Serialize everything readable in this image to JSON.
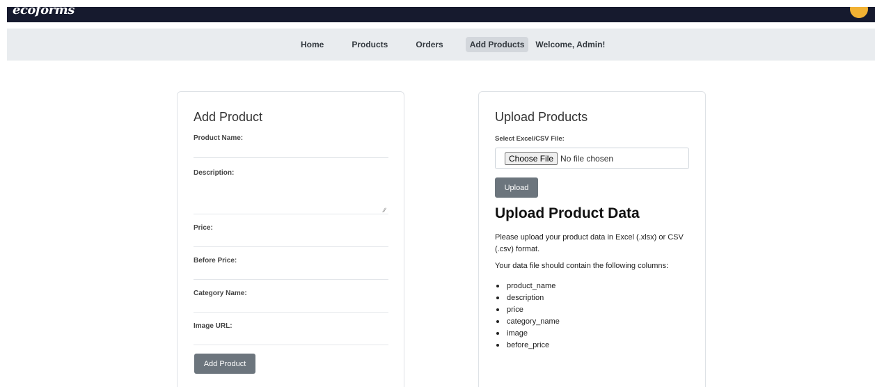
{
  "brand": {
    "logo_text": "ecoforms"
  },
  "nav": {
    "items": [
      {
        "label": "Home"
      },
      {
        "label": "Products"
      },
      {
        "label": "Orders"
      },
      {
        "label": "Add Products"
      }
    ],
    "active": "Add Products",
    "welcome": "Welcome, Admin!"
  },
  "add_product": {
    "title": "Add Product",
    "fields": {
      "product_name": {
        "label": "Product Name:",
        "value": ""
      },
      "description": {
        "label": "Description:",
        "value": ""
      },
      "price": {
        "label": "Price:",
        "value": ""
      },
      "before_price": {
        "label": "Before Price:",
        "value": ""
      },
      "category_name": {
        "label": "Category Name:",
        "value": ""
      },
      "image_url": {
        "label": "Image URL:",
        "value": ""
      }
    },
    "submit_label": "Add Product"
  },
  "upload": {
    "title": "Upload Products",
    "file_label": "Select Excel/CSV File:",
    "choose_label": "Choose File",
    "file_status": "No file chosen",
    "upload_label": "Upload",
    "heading": "Upload Product Data",
    "paragraph1": "Please upload your product data in Excel (.xlsx) or CSV (.csv) format.",
    "paragraph2": "Your data file should contain the following columns:",
    "columns": [
      "product_name",
      "description",
      "price",
      "category_name",
      "image",
      "before_price"
    ]
  },
  "colors": {
    "topbar": "#161a2e",
    "navbar": "#e9ecef",
    "button": "#6c757d",
    "badge": "#f2b233"
  }
}
